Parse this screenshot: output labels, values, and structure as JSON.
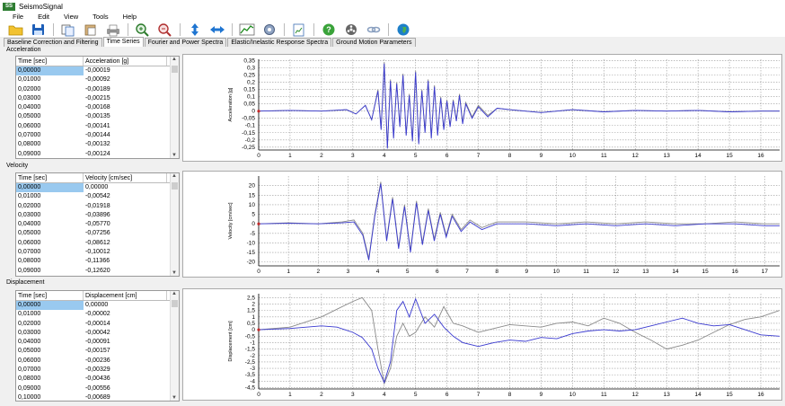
{
  "window": {
    "title": "SeismoSignal"
  },
  "menu": [
    "File",
    "Edit",
    "View",
    "Tools",
    "Help"
  ],
  "toolbar": [
    {
      "icon": "folder-open-icon"
    },
    {
      "icon": "save-icon"
    },
    {
      "sep": true
    },
    {
      "icon": "copy-icon"
    },
    {
      "icon": "paste-icon"
    },
    {
      "icon": "print-icon"
    },
    {
      "sep": true
    },
    {
      "icon": "zoom-in-icon"
    },
    {
      "icon": "zoom-out-icon"
    },
    {
      "sep": true
    },
    {
      "icon": "vertical-arrows-icon"
    },
    {
      "icon": "horizontal-arrows-icon"
    },
    {
      "sep": true
    },
    {
      "icon": "chart-icon"
    },
    {
      "icon": "gear-icon"
    },
    {
      "sep": true
    },
    {
      "icon": "report-icon"
    },
    {
      "sep": true
    },
    {
      "icon": "help-icon"
    },
    {
      "icon": "film-icon"
    },
    {
      "icon": "link-icon"
    },
    {
      "sep": true
    },
    {
      "icon": "globe-icon"
    }
  ],
  "tabs": [
    {
      "label": "Baseline Correction and Filtering",
      "active": false
    },
    {
      "label": "Time Series",
      "active": true
    },
    {
      "label": "Fourier and Power Spectra",
      "active": false
    },
    {
      "label": "Elastic/Inelastic Response Spectra",
      "active": false
    },
    {
      "label": "Ground Motion Parameters",
      "active": false
    }
  ],
  "panels": [
    {
      "label": "Acceleration",
      "col1": "Time [sec]",
      "col2": "Acceleration [g]",
      "rows": [
        [
          "0,00000",
          "-0,00019"
        ],
        [
          "0,01000",
          "-0,00092"
        ],
        [
          "0,02000",
          "-0,00189"
        ],
        [
          "0,03000",
          "-0,00215"
        ],
        [
          "0,04000",
          "-0,00168"
        ],
        [
          "0,05000",
          "-0,00135"
        ],
        [
          "0,06000",
          "-0,00141"
        ],
        [
          "0,07000",
          "-0,00144"
        ],
        [
          "0,08000",
          "-0,00132"
        ],
        [
          "0,09000",
          "-0,00124"
        ],
        [
          "0,10000",
          "-0,00118"
        ]
      ],
      "chart_data": {
        "type": "line",
        "ylabel": "Acceleration [g]",
        "x_ticks": [
          0,
          1,
          2,
          3,
          4,
          5,
          6,
          7,
          8,
          9,
          10,
          11,
          12,
          13,
          14,
          15,
          16
        ],
        "y_ticks": [
          0.35,
          0.3,
          0.25,
          0.2,
          0.15,
          0.1,
          0.05,
          0,
          -0.05,
          -0.1,
          -0.15,
          -0.2,
          -0.25
        ],
        "y_tick_labels": [
          "0,35",
          "0,3",
          "0,25",
          "0,2",
          "0,15",
          "0,1",
          "0,05",
          "0",
          "-0,05",
          "-0,1",
          "-0,15",
          "-0,2",
          "-0,25"
        ],
        "xlim": [
          0,
          16.6
        ],
        "ylim": [
          -0.27,
          0.36
        ],
        "grid": true,
        "series": [
          {
            "color": "#8a8a8a",
            "x": [
              0,
              1,
              2,
              2.8,
              3.1,
              3.4,
              3.6,
              3.8,
              3.9,
              4.0,
              4.1,
              4.2,
              4.3,
              4.4,
              4.5,
              4.6,
              4.7,
              4.8,
              4.9,
              5.0,
              5.1,
              5.2,
              5.3,
              5.4,
              5.5,
              5.6,
              5.7,
              5.8,
              5.9,
              6.0,
              6.1,
              6.2,
              6.3,
              6.4,
              6.5,
              6.6,
              6.8,
              7.0,
              7.3,
              7.6,
              8,
              9,
              10,
              11,
              12,
              13,
              14,
              15,
              16,
              16.6
            ],
            "y": [
              0,
              0.005,
              0,
              0.01,
              -0.02,
              0.04,
              -0.06,
              0.15,
              -0.12,
              0.34,
              -0.25,
              0.22,
              -0.18,
              0.2,
              -0.1,
              0.26,
              -0.16,
              0.12,
              -0.2,
              0.28,
              -0.22,
              0.15,
              -0.14,
              0.22,
              -0.18,
              0.18,
              -0.16,
              0.1,
              -0.12,
              0.08,
              -0.1,
              0.08,
              -0.06,
              0.12,
              -0.08,
              0.06,
              -0.04,
              0.04,
              -0.03,
              0.02,
              0.01,
              -0.01,
              0.01,
              -0.005,
              0.005,
              0,
              0.005,
              -0.005,
              0,
              0
            ]
          },
          {
            "color": "#3a3ad0",
            "x": [
              0,
              1,
              2,
              2.8,
              3.1,
              3.4,
              3.6,
              3.8,
              3.9,
              4.0,
              4.1,
              4.2,
              4.3,
              4.4,
              4.5,
              4.6,
              4.7,
              4.8,
              4.9,
              5.0,
              5.1,
              5.2,
              5.3,
              5.4,
              5.5,
              5.6,
              5.7,
              5.8,
              5.9,
              6.0,
              6.1,
              6.2,
              6.3,
              6.4,
              6.5,
              6.6,
              6.8,
              7.0,
              7.3,
              7.6,
              8,
              9,
              10,
              11,
              12,
              13,
              14,
              15,
              16,
              16.6
            ],
            "y": [
              0,
              0.005,
              0,
              0.01,
              -0.02,
              0.04,
              -0.06,
              0.14,
              -0.13,
              0.33,
              -0.26,
              0.21,
              -0.19,
              0.19,
              -0.11,
              0.25,
              -0.17,
              0.11,
              -0.21,
              0.27,
              -0.23,
              0.14,
              -0.15,
              0.21,
              -0.19,
              0.17,
              -0.17,
              0.09,
              -0.13,
              0.07,
              -0.11,
              0.07,
              -0.07,
              0.11,
              -0.09,
              0.05,
              -0.05,
              0.03,
              -0.04,
              0.02,
              0.01,
              -0.01,
              0.01,
              -0.005,
              0.005,
              0,
              0.005,
              -0.005,
              0,
              0
            ]
          }
        ]
      }
    },
    {
      "label": "Velocity",
      "col1": "Time [sec]",
      "col2": "Velocity [cm/sec]",
      "rows": [
        [
          "0,00000",
          "0,00000"
        ],
        [
          "0,01000",
          "-0,00542"
        ],
        [
          "0,02000",
          "-0,01918"
        ],
        [
          "0,03000",
          "-0,03896"
        ],
        [
          "0,04000",
          "-0,05770"
        ],
        [
          "0,05000",
          "-0,07256"
        ],
        [
          "0,06000",
          "-0,08612"
        ],
        [
          "0,07000",
          "-0,10012"
        ],
        [
          "0,08000",
          "-0,11366"
        ],
        [
          "0,09000",
          "-0,12620"
        ],
        [
          "0,10000",
          "-0,13811"
        ]
      ],
      "chart_data": {
        "type": "line",
        "ylabel": "Velocity [cm/sec]",
        "x_ticks": [
          0,
          1,
          2,
          3,
          4,
          5,
          6,
          7,
          8,
          9,
          10,
          11,
          12,
          13,
          14,
          15,
          16,
          17
        ],
        "y_ticks": [
          20,
          15,
          10,
          5,
          0,
          -5,
          -10,
          -15,
          -20
        ],
        "y_tick_labels": [
          "20",
          "15",
          "10",
          "5",
          "0",
          "-5",
          "-10",
          "-15",
          "-20"
        ],
        "xlim": [
          0,
          17.5
        ],
        "ylim": [
          -22,
          25
        ],
        "grid": true,
        "series": [
          {
            "color": "#8a8a8a",
            "x": [
              0,
              1,
              2,
              2.8,
              3.2,
              3.5,
              3.7,
              3.9,
              4.1,
              4.3,
              4.5,
              4.7,
              4.9,
              5.1,
              5.3,
              5.5,
              5.7,
              5.9,
              6.1,
              6.3,
              6.5,
              6.8,
              7.1,
              7.5,
              8,
              9,
              10,
              11,
              12,
              13,
              14,
              15,
              16,
              17,
              17.5
            ],
            "y": [
              0,
              0.5,
              0,
              1,
              2,
              -5,
              -18,
              5,
              22,
              -8,
              14,
              -12,
              10,
              -14,
              12,
              -10,
              8,
              -8,
              6,
              -6,
              5,
              -3,
              2,
              -2,
              1,
              1,
              0,
              1,
              0,
              1,
              0,
              0,
              1,
              0,
              0
            ]
          },
          {
            "color": "#3a3ad0",
            "x": [
              0,
              1,
              2,
              2.8,
              3.2,
              3.5,
              3.7,
              3.9,
              4.1,
              4.3,
              4.5,
              4.7,
              4.9,
              5.1,
              5.3,
              5.5,
              5.7,
              5.9,
              6.1,
              6.3,
              6.5,
              6.8,
              7.1,
              7.5,
              8,
              9,
              10,
              11,
              12,
              13,
              14,
              15,
              16,
              17,
              17.5
            ],
            "y": [
              0,
              0.3,
              0,
              0.5,
              1,
              -6,
              -19,
              4,
              21,
              -9,
              13,
              -13,
              9,
              -15,
              11,
              -11,
              7,
              -9,
              5,
              -7,
              4,
              -4,
              1,
              -3,
              0,
              0,
              -1,
              0,
              -1,
              0,
              -1,
              0,
              0,
              -1,
              -1
            ]
          }
        ]
      }
    },
    {
      "label": "Displacement",
      "col1": "Time [sec]",
      "col2": "Displacement [cm]",
      "rows": [
        [
          "0,00000",
          "0,00000"
        ],
        [
          "0,01000",
          "-0,00002"
        ],
        [
          "0,02000",
          "-0,00014"
        ],
        [
          "0,03000",
          "-0,00042"
        ],
        [
          "0,04000",
          "-0,00091"
        ],
        [
          "0,05000",
          "-0,00157"
        ],
        [
          "0,06000",
          "-0,00236"
        ],
        [
          "0,07000",
          "-0,00329"
        ],
        [
          "0,08000",
          "-0,00436"
        ],
        [
          "0,09000",
          "-0,00556"
        ],
        [
          "0,10000",
          "-0,00689"
        ]
      ],
      "chart_data": {
        "type": "line",
        "ylabel": "Displacement [cm]",
        "x_ticks": [
          0,
          1,
          2,
          3,
          4,
          5,
          6,
          7,
          8,
          9,
          10,
          11,
          12,
          13,
          14,
          15,
          16
        ],
        "y_ticks": [
          2.5,
          2,
          1.5,
          1,
          0.5,
          0,
          -0.5,
          -1,
          -1.5,
          -2,
          -2.5,
          -3,
          -3.5,
          -4,
          -4.5
        ],
        "y_tick_labels": [
          "2,5",
          "2",
          "1,5",
          "1",
          "0,5",
          "0",
          "-0,5",
          "-1",
          "-1,5",
          "-2",
          "-2,5",
          "-3",
          "-3,5",
          "-4",
          "-4,5"
        ],
        "xlim": [
          0,
          16.6
        ],
        "ylim": [
          -4.6,
          2.8
        ],
        "grid": true,
        "series": [
          {
            "color": "#8a8a8a",
            "x": [
              0,
              1,
              2,
              2.5,
              3,
              3.3,
              3.6,
              3.8,
              4.0,
              4.2,
              4.4,
              4.6,
              4.8,
              5.0,
              5.3,
              5.6,
              5.9,
              6.2,
              6.5,
              7,
              7.5,
              8,
              8.5,
              9,
              9.5,
              10,
              10.5,
              11,
              11.5,
              12,
              12.5,
              13,
              13.5,
              14,
              14.5,
              15,
              15.5,
              16,
              16.6
            ],
            "y": [
              0,
              0.2,
              1,
              1.6,
              2.2,
              2.5,
              1.5,
              -1.5,
              -4.2,
              -3,
              -0.5,
              0.5,
              -0.5,
              -0.2,
              1,
              0.2,
              1.8,
              0.5,
              0.3,
              -0.2,
              0.1,
              0.4,
              0.3,
              0.2,
              0.5,
              0.6,
              0.3,
              0.9,
              0.5,
              -0.2,
              -0.8,
              -1.5,
              -1.2,
              -0.8,
              -0.2,
              0.4,
              0.8,
              1.0,
              1.5
            ]
          },
          {
            "color": "#3a3ad0",
            "x": [
              0,
              1,
              2,
              2.5,
              3,
              3.3,
              3.6,
              3.8,
              4.0,
              4.2,
              4.4,
              4.6,
              4.8,
              5.0,
              5.3,
              5.6,
              5.9,
              6.2,
              6.5,
              7,
              7.5,
              8,
              8.5,
              9,
              9.5,
              10,
              10.5,
              11,
              11.5,
              12,
              12.5,
              13,
              13.5,
              14,
              14.5,
              15,
              15.5,
              16,
              16.6
            ],
            "y": [
              0,
              0.1,
              0.3,
              0.2,
              -0.2,
              -0.6,
              -1.5,
              -3,
              -4.1,
              -2.5,
              1.5,
              2.2,
              1,
              2.4,
              0.5,
              1.2,
              0.2,
              -0.5,
              -1,
              -1.3,
              -1.0,
              -0.8,
              -0.9,
              -0.6,
              -0.7,
              -0.3,
              -0.1,
              0,
              -0.1,
              0,
              0.3,
              0.6,
              0.9,
              0.5,
              0.3,
              0.4,
              0,
              -0.4,
              -0.5
            ]
          }
        ]
      }
    }
  ]
}
